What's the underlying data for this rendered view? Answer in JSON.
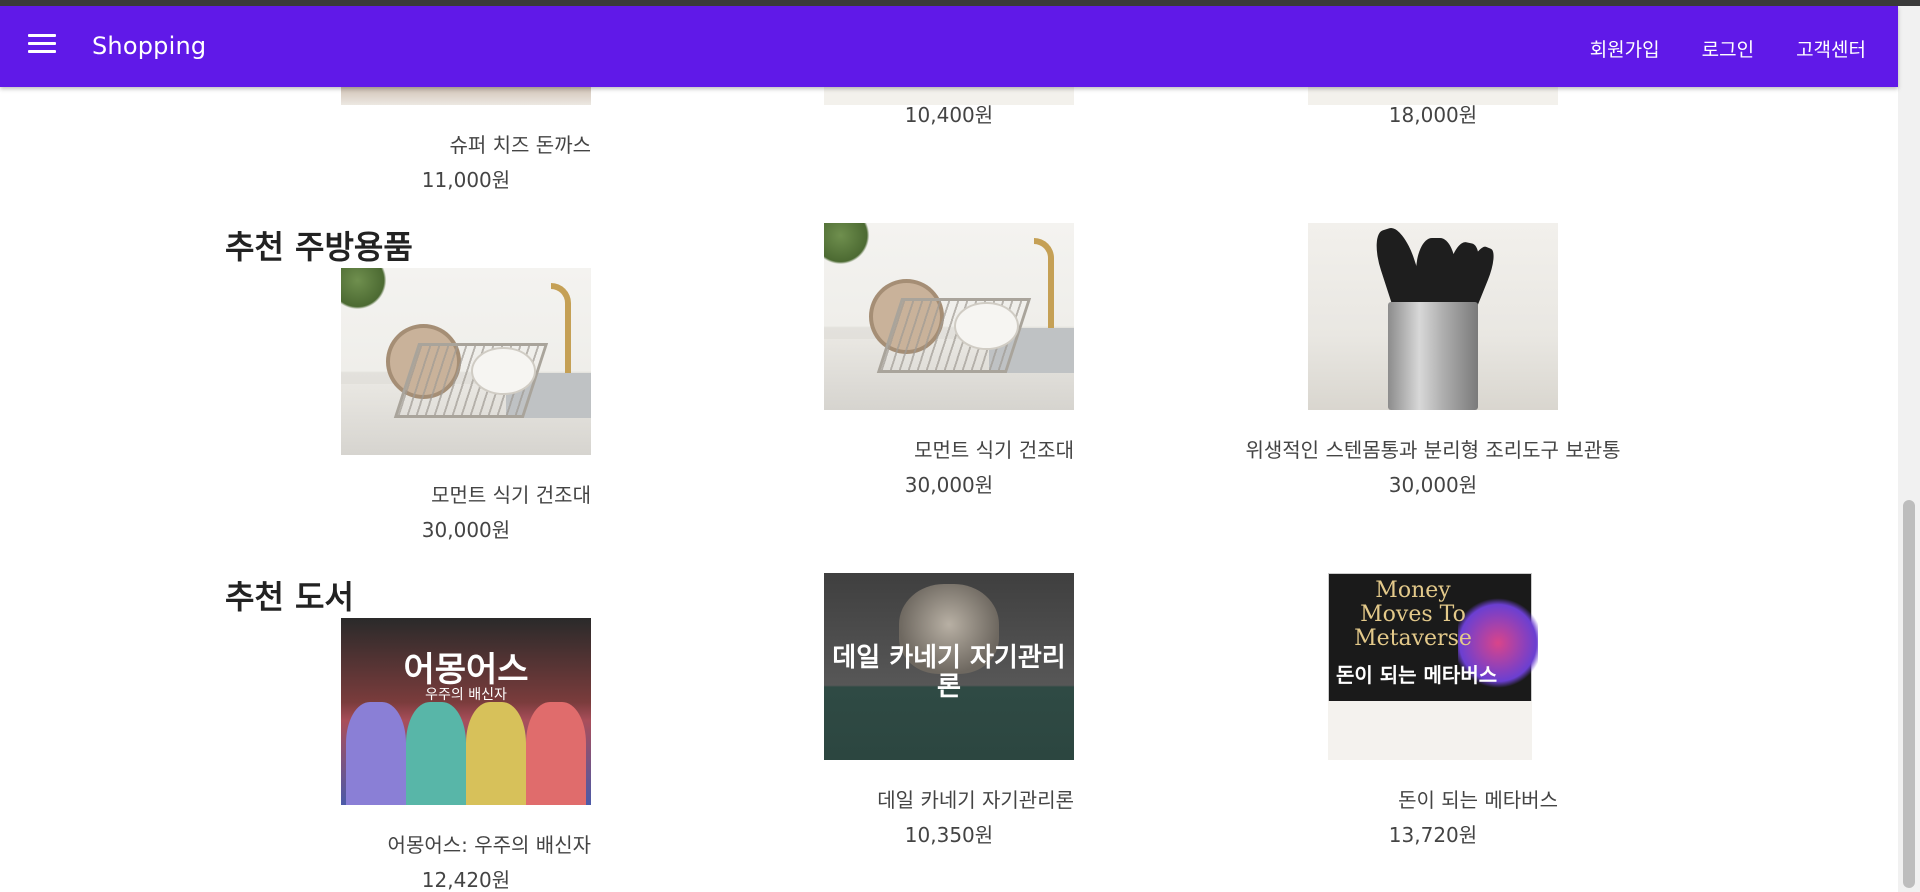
{
  "appbar": {
    "title": "Shopping",
    "nav": [
      "회원가입",
      "로그인",
      "고객센터"
    ]
  },
  "top_row": [
    {
      "name": "슈퍼 치즈 돈까스",
      "price": "11,000원"
    },
    {
      "name": "",
      "price": "10,400원"
    },
    {
      "name": "",
      "price": "18,000원"
    }
  ],
  "sections": [
    {
      "title": "추천 주방용품",
      "items": [
        {
          "name": "모먼트 식기 건조대",
          "price": "30,000원"
        },
        {
          "name": "모먼트 식기 건조대",
          "price": "30,000원"
        },
        {
          "name": "위생적인 스텐몸통과 분리형 조리도구 보관통",
          "price": "30,000원"
        }
      ]
    },
    {
      "title": "추천 도서",
      "items": [
        {
          "name": "어몽어스: 우주의 배신자",
          "price": "12,420원",
          "cover_text": "어몽어스",
          "cover_sub": "우주의 배신자"
        },
        {
          "name": "데일 카네기 자기관리론",
          "price": "10,350원",
          "cover_text": "데일 카네기 자기관리론"
        },
        {
          "name": "돈이 되는 메타버스",
          "price": "13,720원",
          "cover_text": "Money Moves To Metaverse",
          "cover_sub": "돈이 되는 메타버스"
        }
      ]
    }
  ],
  "colors": {
    "appbar": "#6019e8"
  }
}
